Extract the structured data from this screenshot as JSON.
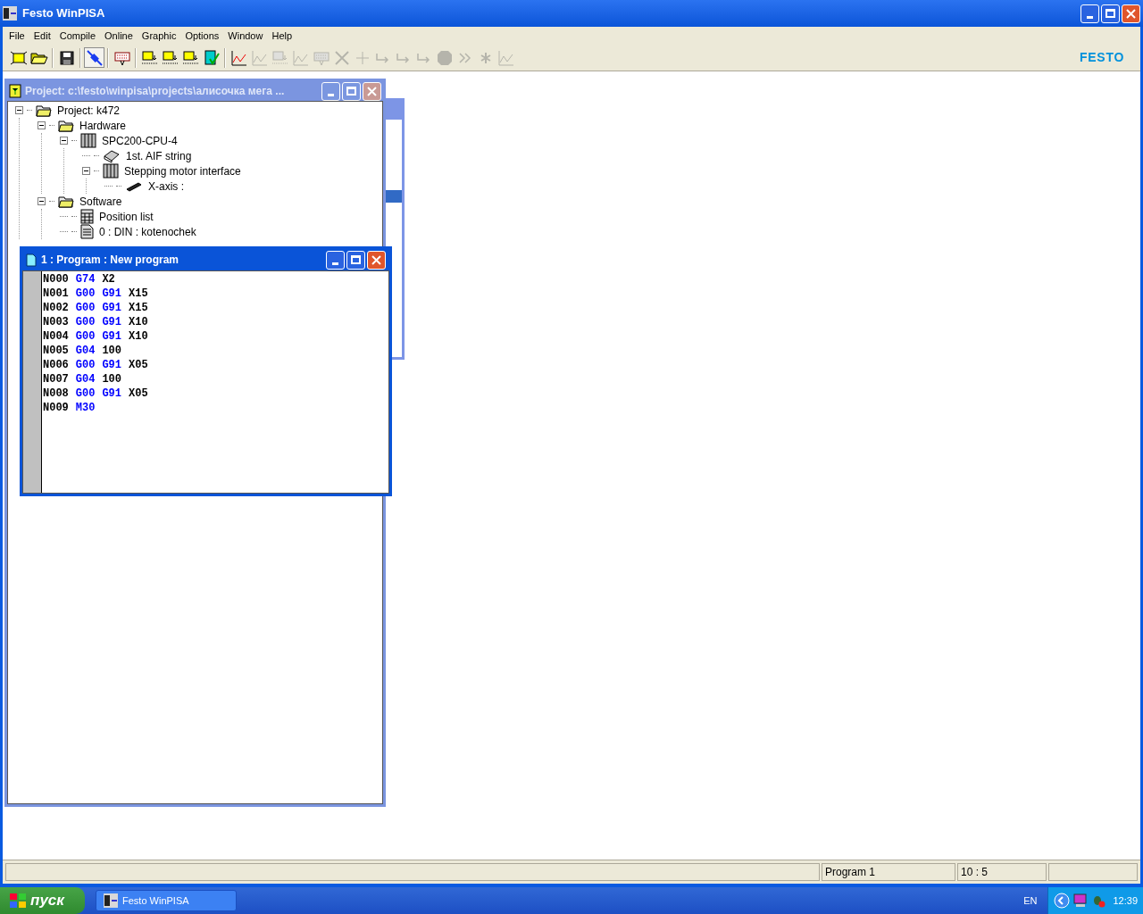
{
  "window": {
    "title": "Festo WinPISA"
  },
  "menu": [
    "File",
    "Edit",
    "Compile",
    "Online",
    "Graphic",
    "Options",
    "Window",
    "Help"
  ],
  "toolbar": [
    {
      "kind": "new",
      "disabled": false,
      "pressed": false
    },
    {
      "kind": "open",
      "disabled": false,
      "pressed": false
    },
    {
      "kind": "separator"
    },
    {
      "kind": "save",
      "disabled": false,
      "pressed": false
    },
    {
      "kind": "separator"
    },
    {
      "kind": "connect",
      "disabled": false,
      "pressed": true
    },
    {
      "kind": "separator"
    },
    {
      "kind": "keyboard",
      "disabled": false,
      "pressed": false
    },
    {
      "kind": "separator"
    },
    {
      "kind": "load",
      "disabled": false,
      "pressed": false
    },
    {
      "kind": "load",
      "disabled": false,
      "pressed": false
    },
    {
      "kind": "load",
      "disabled": false,
      "pressed": false
    },
    {
      "kind": "check",
      "disabled": false,
      "pressed": false
    },
    {
      "kind": "separator"
    },
    {
      "kind": "graph",
      "disabled": false,
      "pressed": false
    },
    {
      "kind": "graph",
      "disabled": true,
      "pressed": false
    },
    {
      "kind": "load",
      "disabled": true,
      "pressed": false
    },
    {
      "kind": "graph",
      "disabled": true,
      "pressed": false
    },
    {
      "kind": "keyboard",
      "disabled": true,
      "pressed": false
    },
    {
      "kind": "tool",
      "disabled": true,
      "pressed": false
    },
    {
      "kind": "plus",
      "disabled": true,
      "pressed": false
    },
    {
      "kind": "step",
      "disabled": true,
      "pressed": false
    },
    {
      "kind": "step",
      "disabled": true,
      "pressed": false
    },
    {
      "kind": "step",
      "disabled": true,
      "pressed": false
    },
    {
      "kind": "stop",
      "disabled": true,
      "pressed": false
    },
    {
      "kind": "forward",
      "disabled": true,
      "pressed": false
    },
    {
      "kind": "star",
      "disabled": true,
      "pressed": false
    },
    {
      "kind": "graph",
      "disabled": true,
      "pressed": false
    }
  ],
  "logo": "FESTO",
  "project_window": {
    "title": "Project: c:\\festo\\winpisa\\projects\\алисочка мега ...",
    "active": false,
    "tree": [
      {
        "label": "Project: k472",
        "kind": "folder",
        "expanded": true,
        "children": [
          {
            "label": "Hardware",
            "kind": "folder",
            "expanded": true,
            "children": [
              {
                "label": "SPC200-CPU-4",
                "kind": "cpu",
                "expanded": true,
                "children": [
                  {
                    "label": "1st. AIF string",
                    "kind": "module"
                  },
                  {
                    "label": "Stepping motor interface",
                    "kind": "cpu",
                    "expanded": true,
                    "children": [
                      {
                        "label": "X-axis :",
                        "kind": "axis"
                      }
                    ]
                  }
                ]
              }
            ]
          },
          {
            "label": "Software",
            "kind": "folder",
            "expanded": true,
            "children": [
              {
                "label": "Position list",
                "kind": "table"
              },
              {
                "label": "0 : DIN : kotenochek",
                "kind": "document"
              }
            ]
          }
        ]
      }
    ]
  },
  "program_window": {
    "title": "1 : Program : New program",
    "active": true,
    "lines": [
      [
        {
          "text": "N000",
          "kind": "address"
        },
        {
          "text": "G74",
          "kind": "command"
        },
        {
          "text": "X2",
          "kind": "value"
        }
      ],
      [
        {
          "text": "N001",
          "kind": "address"
        },
        {
          "text": "G00",
          "kind": "command"
        },
        {
          "text": "G91",
          "kind": "command"
        },
        {
          "text": "X15",
          "kind": "value"
        }
      ],
      [
        {
          "text": "N002",
          "kind": "address"
        },
        {
          "text": "G00",
          "kind": "command"
        },
        {
          "text": "G91",
          "kind": "command"
        },
        {
          "text": "X15",
          "kind": "value"
        }
      ],
      [
        {
          "text": "N003",
          "kind": "address"
        },
        {
          "text": "G00",
          "kind": "command"
        },
        {
          "text": "G91",
          "kind": "command"
        },
        {
          "text": "X10",
          "kind": "value"
        }
      ],
      [
        {
          "text": "N004",
          "kind": "address"
        },
        {
          "text": "G00",
          "kind": "command"
        },
        {
          "text": "G91",
          "kind": "command"
        },
        {
          "text": "X10",
          "kind": "value"
        }
      ],
      [
        {
          "text": "N005",
          "kind": "address"
        },
        {
          "text": "G04",
          "kind": "command"
        },
        {
          "text": "100",
          "kind": "value"
        }
      ],
      [
        {
          "text": "N006",
          "kind": "address"
        },
        {
          "text": "G00",
          "kind": "command"
        },
        {
          "text": "G91",
          "kind": "command"
        },
        {
          "text": "X05",
          "kind": "value"
        }
      ],
      [
        {
          "text": "N007",
          "kind": "address"
        },
        {
          "text": "G04",
          "kind": "command"
        },
        {
          "text": "100",
          "kind": "value"
        }
      ],
      [
        {
          "text": "N008",
          "kind": "address"
        },
        {
          "text": "G00",
          "kind": "command"
        },
        {
          "text": "G91",
          "kind": "command"
        },
        {
          "text": "X05",
          "kind": "value"
        }
      ],
      [
        {
          "text": "N009",
          "kind": "address"
        },
        {
          "text": "M30",
          "kind": "command"
        }
      ]
    ]
  },
  "status_bar": {
    "document": "Program 1",
    "position": "10 : 5"
  },
  "taskbar": {
    "start": "пуск",
    "tasks": [
      {
        "label": "Festo WinPISA",
        "selected": false
      }
    ],
    "language": "EN",
    "clock": "12:39"
  }
}
